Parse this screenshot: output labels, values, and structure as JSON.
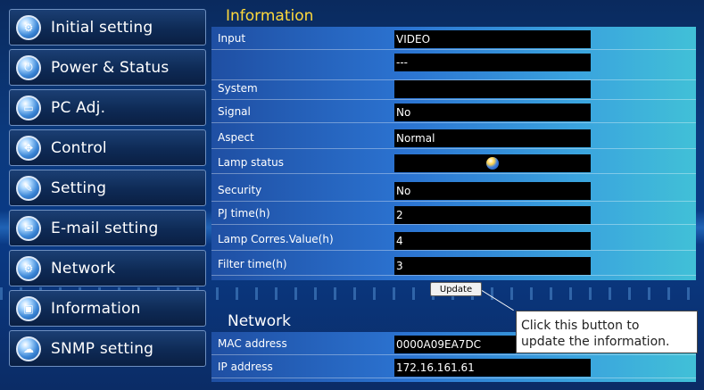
{
  "sidebar": {
    "items": [
      {
        "label": "Initial setting",
        "icon": "gear-icon"
      },
      {
        "label": "Power & Status",
        "icon": "power-icon"
      },
      {
        "label": "PC Adj.",
        "icon": "monitor-icon"
      },
      {
        "label": "Control",
        "icon": "dpad-icon"
      },
      {
        "label": "Setting",
        "icon": "wrench-icon"
      },
      {
        "label": "E-mail setting",
        "icon": "envelope-icon"
      },
      {
        "label": "Network",
        "icon": "network-icon"
      },
      {
        "label": "Information",
        "icon": "info-icon"
      },
      {
        "label": "SNMP setting",
        "icon": "snmp-icon"
      }
    ]
  },
  "information": {
    "title": "Information",
    "rows": [
      {
        "label": "Input",
        "value": "VIDEO"
      },
      {
        "label": "",
        "value": "---"
      },
      {
        "label": "System",
        "value": ""
      },
      {
        "label": "Signal",
        "value": "No"
      },
      {
        "label": "Aspect",
        "value": "Normal"
      },
      {
        "label": "Lamp status",
        "value": ""
      },
      {
        "label": "Security",
        "value": "No"
      },
      {
        "label": "PJ time(h)",
        "value": "2"
      },
      {
        "label": "Lamp Corres.Value(h)",
        "value": "4"
      },
      {
        "label": "Filter time(h)",
        "value": "3"
      }
    ],
    "update_label": "Update"
  },
  "network": {
    "title": "Network",
    "rows": [
      {
        "label": "MAC address",
        "value": "0000A09EA7DC"
      },
      {
        "label": "IP address",
        "value": "172.16.161.61"
      }
    ]
  },
  "callout": {
    "line1": "Click this button to",
    "line2": "update the information."
  }
}
